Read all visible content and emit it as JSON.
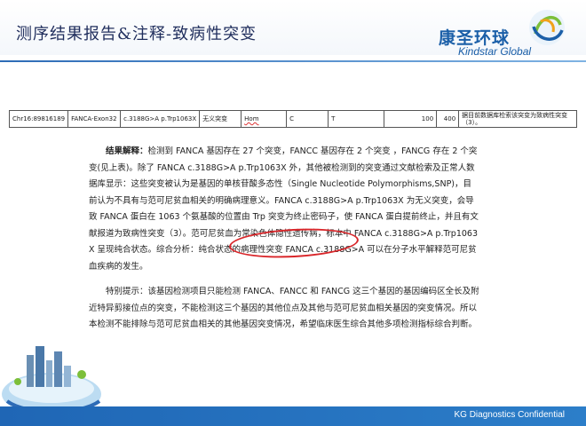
{
  "header": {
    "title": "测序结果报告&注释-致病性突变",
    "logo_cn": "康圣环球",
    "logo_en": "Kindstar Global"
  },
  "table": {
    "row": [
      "Chr16:89816189",
      "FANCA-Exon32",
      "c.3188G>A p.Trp1063X",
      "无义突变",
      "Hom",
      "C",
      "T",
      "100",
      "400",
      "据目前数据库检索该突变为致病性突变（3）。"
    ]
  },
  "paragraph1": {
    "lead": "结果解释：",
    "body": "检测到 FANCA 基因存在 27 个突变，FANCC 基因存在 2 个突变 ，FANCG 存在 2 个突变(见上表)。除了 FANCA c.3188G>A p.Trp1063X 外，其他被检测到的突变通过文献检索及正常人数据库显示：这些突变被认为是基因的单核苷酸多态性（Single Nucleotide Polymorphisms,SNP)，目前认为不具有与范可尼贫血相关的明确病理意义。FANCA c.3188G>A p.Trp1063X 为无义突变，会导致 FANCA 蛋白在 1063 个氨基酸的位置由 Trp 突变为终止密码子，使 FANCA 蛋白提前终止，并且有文献报道为致病性突变（3）。范可尼贫血为常染色体隐性遗传病，标本中 FANCA c.3188G>A p.Trp1063X 呈现纯合状态。综合分析：纯合状态的病理性突变 FANCA c.3188G>A 可以在分子水平解释范可尼贫血疾病的发生。"
  },
  "paragraph2": {
    "lead": "特别提示：",
    "body": "该基因检测项目只能检测 FANCA、FANCC 和 FANCG 这三个基因的基因编码区全长及附近特异剪接位点的突变，不能检测这三个基因的其他位点及其他与范可尼贫血相关基因的突变情况。所以本检测不能排除与范可尼贫血相关的其他基因突变情况，希望临床医生综合其他多项检测指标综合判断。"
  },
  "footer": {
    "text": "KG Diagnostics Confidential"
  }
}
